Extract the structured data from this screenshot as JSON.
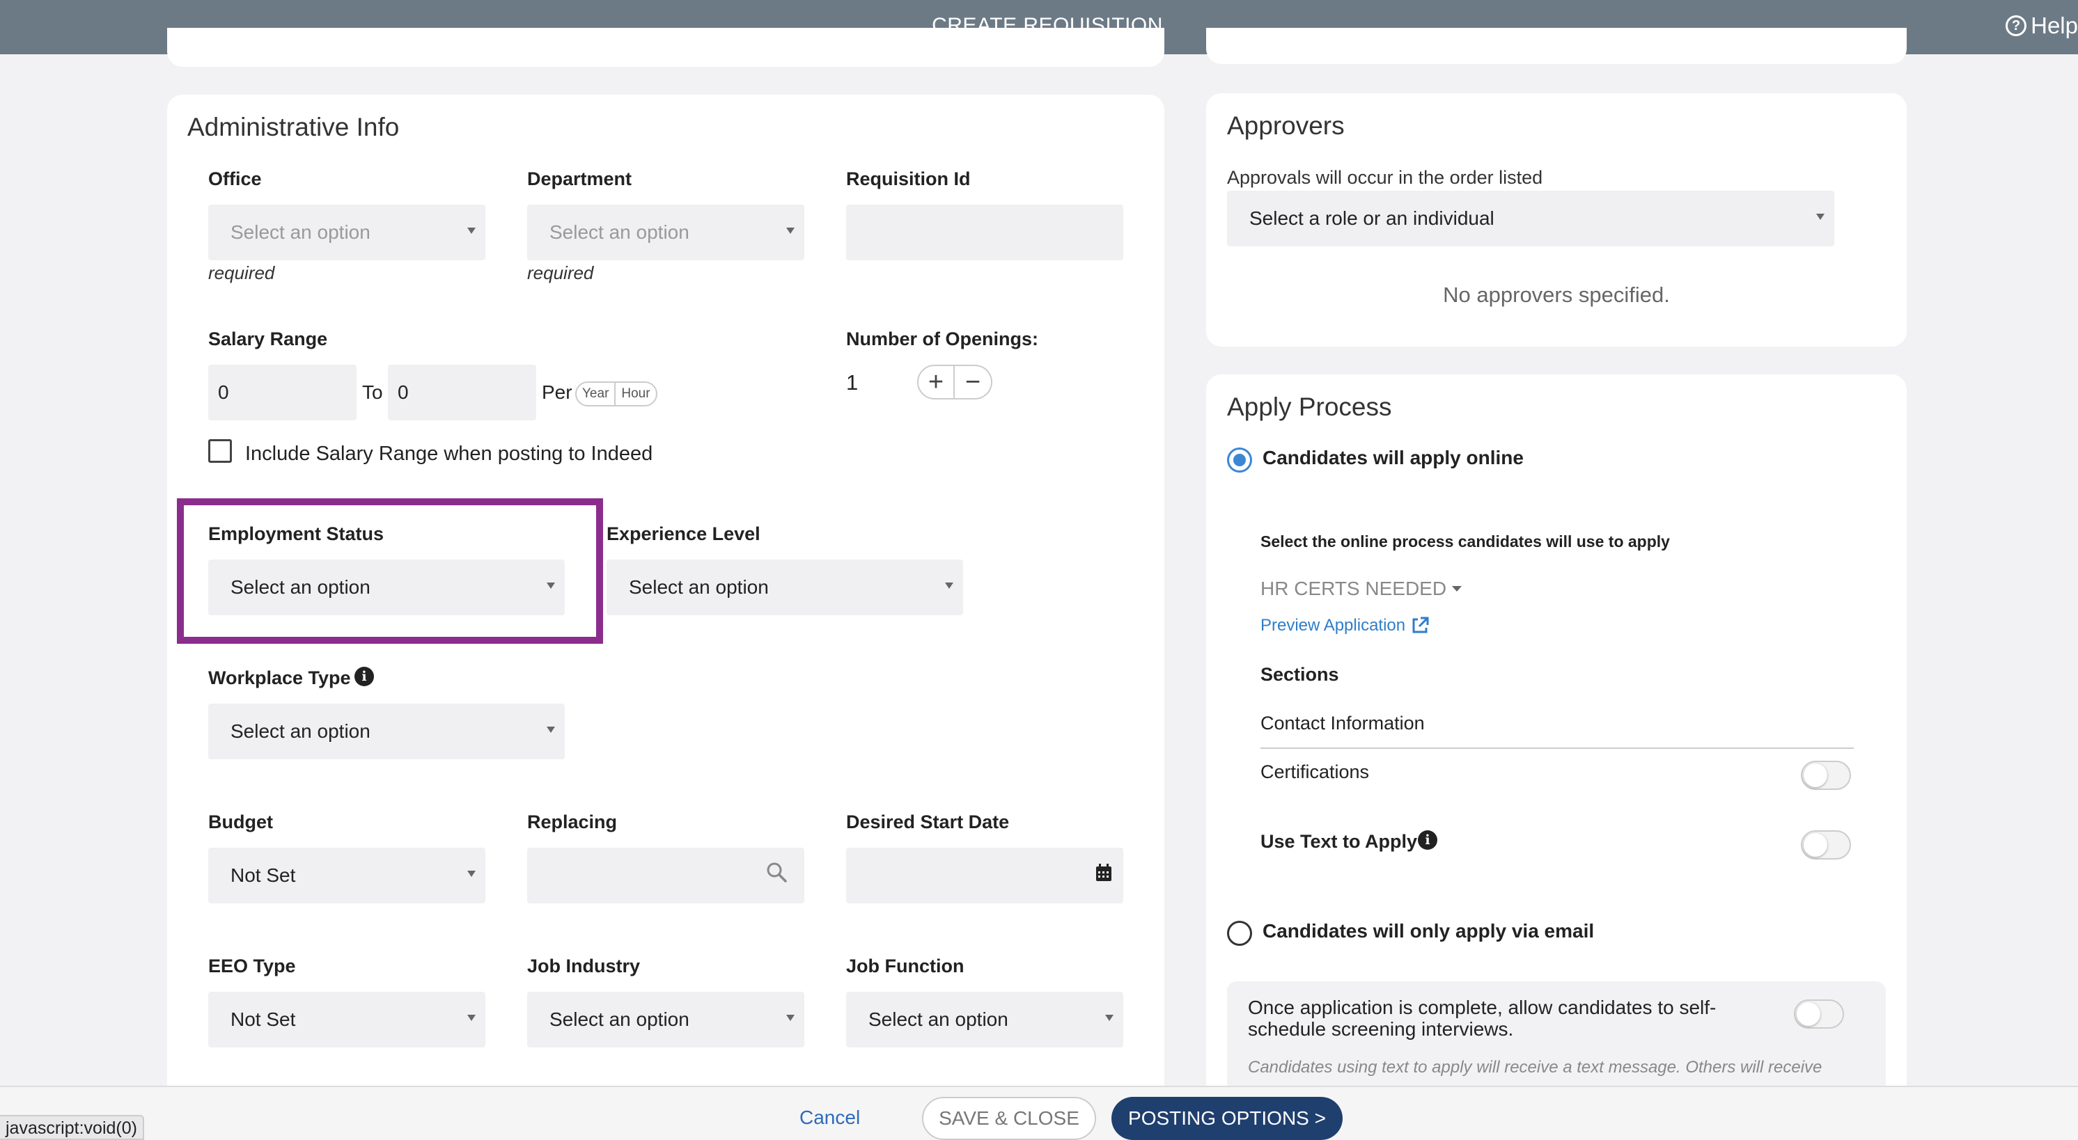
{
  "header": {
    "title": "CREATE REQUISITION",
    "help_label": "Help"
  },
  "admin": {
    "title": "Administrative Info",
    "office": {
      "label": "Office",
      "value": "Select an option",
      "hint": "required"
    },
    "department": {
      "label": "Department",
      "value": "Select an option",
      "hint": "required"
    },
    "requisition_id": {
      "label": "Requisition Id",
      "value": ""
    },
    "salary": {
      "label": "Salary Range",
      "min": "0",
      "to_label": "To",
      "max": "0",
      "per_label": "Per",
      "period_options": [
        "Year",
        "Hour"
      ]
    },
    "openings": {
      "label": "Number of Openings:",
      "value": "1",
      "plus": "+",
      "minus": "−"
    },
    "include_salary": {
      "label": "Include Salary Range when posting to Indeed",
      "checked": false
    },
    "employment_status": {
      "label": "Employment Status",
      "value": "Select an option"
    },
    "experience_level": {
      "label": "Experience Level",
      "value": "Select an option"
    },
    "workplace_type": {
      "label": "Workplace Type",
      "value": "Select an option"
    },
    "budget": {
      "label": "Budget",
      "value": "Not Set"
    },
    "replacing": {
      "label": "Replacing",
      "value": ""
    },
    "desired_start_date": {
      "label": "Desired Start Date",
      "value": ""
    },
    "eeo_type": {
      "label": "EEO Type",
      "value": "Not Set"
    },
    "job_industry": {
      "label": "Job Industry",
      "value": "Select an option"
    },
    "job_function": {
      "label": "Job Function",
      "value": "Select an option"
    }
  },
  "approvers": {
    "title": "Approvers",
    "note": "Approvals will occur in the order listed",
    "select_value": "Select a role or an individual",
    "empty": "No approvers specified."
  },
  "apply": {
    "title": "Apply Process",
    "online_label": "Candidates will apply online",
    "online_selected": true,
    "process_prompt": "Select the online process candidates will use to apply",
    "process_value": "HR CERTS NEEDED",
    "preview_link": "Preview Application",
    "sections_label": "Sections",
    "sections": [
      {
        "name": "Contact Information",
        "toggle": null
      },
      {
        "name": "Certifications",
        "toggle": false
      }
    ],
    "text_to_apply": {
      "label": "Use Text to Apply",
      "on": false
    },
    "email_label": "Candidates will only apply via email",
    "self_schedule": {
      "text": "Once application is complete, allow candidates to self-schedule screening interviews.",
      "on": false
    },
    "note": "Candidates using text to apply will receive a text message. Others will receive"
  },
  "footer": {
    "cancel": "Cancel",
    "save_close": "SAVE & CLOSE",
    "posting_options": "POSTING OPTIONS >"
  },
  "status_bar": "javascript:void(0)",
  "colors": {
    "header": "#6c7a86",
    "accent": "#3b87d6",
    "primary_button": "#1f3f6e",
    "highlight": "#8b2d8c"
  }
}
